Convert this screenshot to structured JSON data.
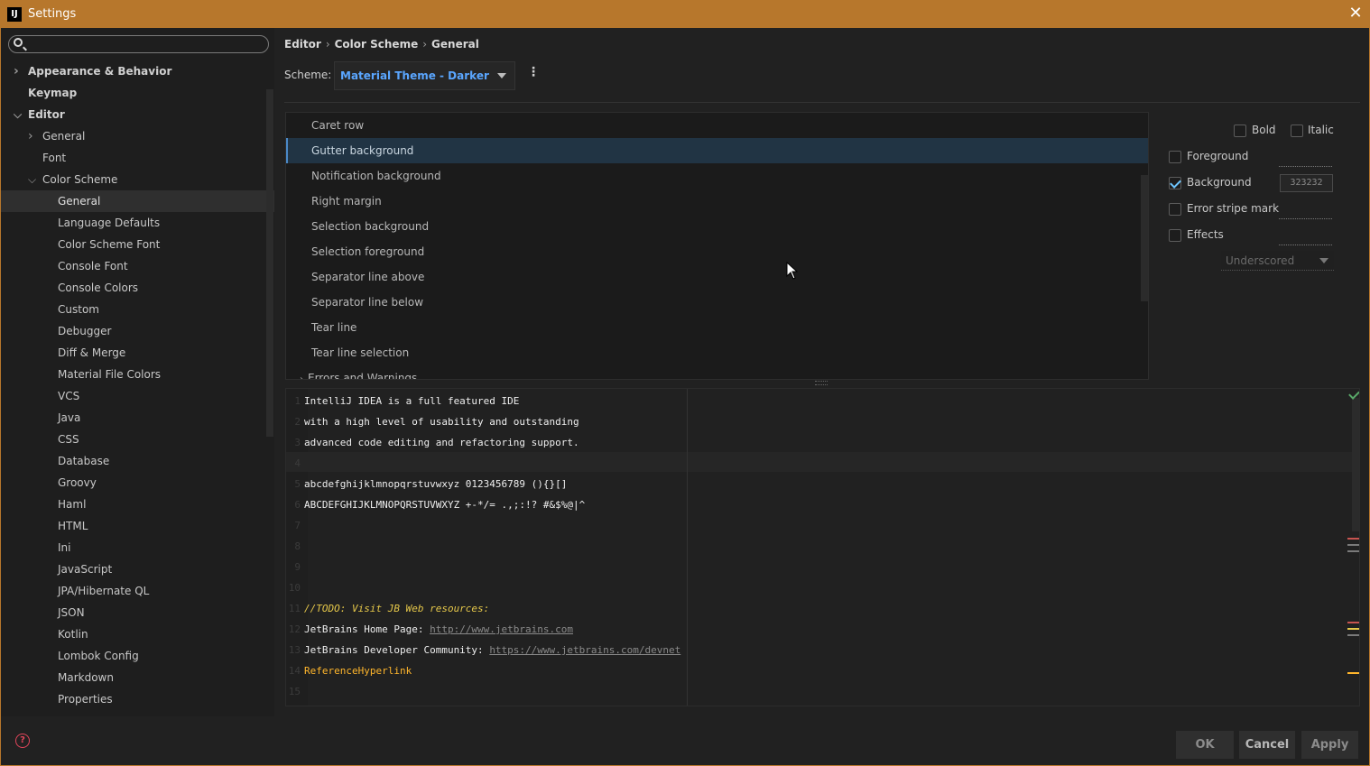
{
  "window": {
    "app_icon": "IJ",
    "title": "Settings",
    "close": "✕"
  },
  "search": {
    "placeholder": "",
    "icon": "search-icon"
  },
  "sidebar": {
    "items": [
      {
        "label": "Appearance & Behavior",
        "level": 0,
        "bold": true,
        "arrow": "right"
      },
      {
        "label": "Keymap",
        "level": 0,
        "bold": true,
        "arrow": ""
      },
      {
        "label": "Editor",
        "level": 0,
        "bold": true,
        "arrow": "down"
      },
      {
        "label": "General",
        "level": 1,
        "bold": false,
        "arrow": "right"
      },
      {
        "label": "Font",
        "level": 1,
        "bold": false,
        "arrow": ""
      },
      {
        "label": "Color Scheme",
        "level": 1,
        "bold": false,
        "arrow": "down"
      },
      {
        "label": "General",
        "level": 2,
        "bold": false,
        "arrow": "",
        "selected": true
      },
      {
        "label": "Language Defaults",
        "level": 2
      },
      {
        "label": "Color Scheme Font",
        "level": 2
      },
      {
        "label": "Console Font",
        "level": 2
      },
      {
        "label": "Console Colors",
        "level": 2
      },
      {
        "label": "Custom",
        "level": 2
      },
      {
        "label": "Debugger",
        "level": 2
      },
      {
        "label": "Diff & Merge",
        "level": 2
      },
      {
        "label": "Material File Colors",
        "level": 2
      },
      {
        "label": "VCS",
        "level": 2
      },
      {
        "label": "Java",
        "level": 2
      },
      {
        "label": "CSS",
        "level": 2
      },
      {
        "label": "Database",
        "level": 2
      },
      {
        "label": "Groovy",
        "level": 2
      },
      {
        "label": "Haml",
        "level": 2
      },
      {
        "label": "HTML",
        "level": 2
      },
      {
        "label": "Ini",
        "level": 2
      },
      {
        "label": "JavaScript",
        "level": 2
      },
      {
        "label": "JPA/Hibernate QL",
        "level": 2
      },
      {
        "label": "JSON",
        "level": 2
      },
      {
        "label": "Kotlin",
        "level": 2
      },
      {
        "label": "Lombok Config",
        "level": 2
      },
      {
        "label": "Markdown",
        "level": 2
      },
      {
        "label": "Properties",
        "level": 2
      }
    ]
  },
  "breadcrumb": [
    "Editor",
    "Color Scheme",
    "General"
  ],
  "scheme": {
    "label": "Scheme:",
    "value": "Material Theme - Darker"
  },
  "elements": {
    "items": [
      {
        "label": "Caret row"
      },
      {
        "label": "Gutter background",
        "selected": true
      },
      {
        "label": "Notification background"
      },
      {
        "label": "Right margin"
      },
      {
        "label": "Selection background"
      },
      {
        "label": "Selection foreground"
      },
      {
        "label": "Separator line above"
      },
      {
        "label": "Separator line below"
      },
      {
        "label": "Tear line"
      },
      {
        "label": "Tear line selection"
      },
      {
        "label": "Errors and Warnings",
        "group": true
      }
    ]
  },
  "props": {
    "bold": "Bold",
    "italic": "Italic",
    "foreground": "Foreground",
    "background": "Background",
    "background_value": "323232",
    "error_stripe": "Error stripe mark",
    "effects": "Effects",
    "effect_type": "Underscored"
  },
  "preview": {
    "lines": [
      {
        "n": "1",
        "parts": [
          {
            "t": "IntelliJ IDEA is a full featured IDE",
            "c": "txt"
          }
        ]
      },
      {
        "n": "2",
        "parts": [
          {
            "t": "with a high level of usability and outstanding",
            "c": "txt"
          }
        ]
      },
      {
        "n": "3",
        "parts": [
          {
            "t": "advanced code editing and refactoring support.",
            "c": "txt"
          }
        ]
      },
      {
        "n": "4",
        "parts": []
      },
      {
        "n": "5",
        "parts": [
          {
            "t": "abcdefghijklmnopqrstuvwxyz 0123456789 (){}[]",
            "c": "txt"
          }
        ]
      },
      {
        "n": "6",
        "parts": [
          {
            "t": "ABCDEFGHIJKLMNOPQRSTUVWXYZ +-*/= .,;:!? #&$%@|^",
            "c": "txt"
          }
        ]
      },
      {
        "n": "7",
        "parts": []
      },
      {
        "n": "8",
        "parts": []
      },
      {
        "n": "9",
        "parts": []
      },
      {
        "n": "10",
        "parts": []
      },
      {
        "n": "11",
        "parts": [
          {
            "t": "//TODO: Visit JB Web resources:",
            "c": "todo"
          }
        ]
      },
      {
        "n": "12",
        "parts": [
          {
            "t": "JetBrains Home Page: ",
            "c": "txt"
          },
          {
            "t": "http://www.jetbrains.com",
            "c": "link"
          }
        ]
      },
      {
        "n": "13",
        "parts": [
          {
            "t": "JetBrains Developer Community: ",
            "c": "txt"
          },
          {
            "t": "https://www.jetbrains.com/devnet",
            "c": "link"
          }
        ]
      },
      {
        "n": "14",
        "parts": [
          {
            "t": "ReferenceHyperlink",
            "c": "ref"
          }
        ]
      },
      {
        "n": "15",
        "parts": []
      }
    ]
  },
  "buttons": {
    "ok": "OK",
    "cancel": "Cancel",
    "apply": "Apply"
  },
  "colors": {
    "title_bar": "#b7772c",
    "accent": "#5aa6ff",
    "selection": "#213444",
    "todo": "#e6c84a",
    "reference": "#ffb62c",
    "help": "#e0455a"
  }
}
